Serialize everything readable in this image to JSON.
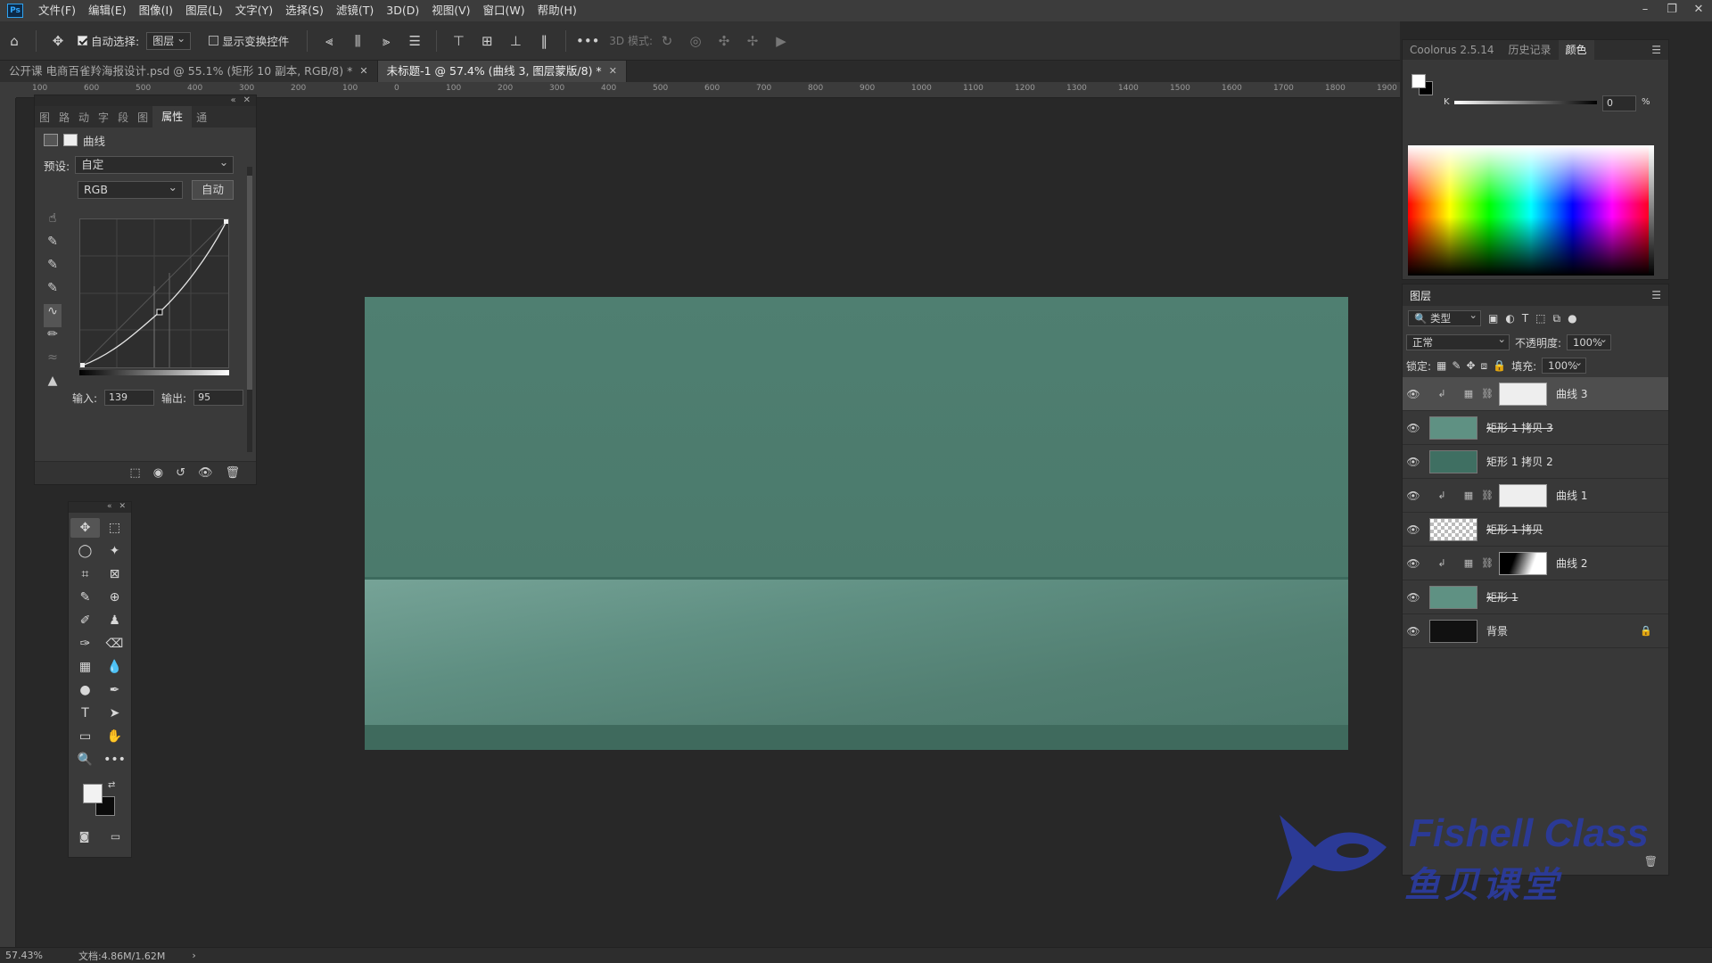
{
  "menubar": {
    "items": [
      "文件(F)",
      "编辑(E)",
      "图像(I)",
      "图层(L)",
      "文字(Y)",
      "选择(S)",
      "滤镜(T)",
      "3D(D)",
      "视图(V)",
      "窗口(W)",
      "帮助(H)"
    ]
  },
  "options": {
    "auto_select_label": "自动选择:",
    "auto_select_value": "图层",
    "show_transform_label": "显示变换控件",
    "mode_3d_label": "3D 模式:"
  },
  "tabs": [
    {
      "label": "公开课 电商百雀羚海报设计.psd @ 55.1% (矩形 10 副本, RGB/8) *"
    },
    {
      "label": "未标题-1 @ 57.4% (曲线 3, 图层蒙版/8) *"
    }
  ],
  "ruler": {
    "h_ticks": [
      "100",
      "600",
      "500",
      "400",
      "300",
      "200",
      "100",
      "0",
      "100",
      "200",
      "300",
      "400",
      "500",
      "600",
      "700",
      "800",
      "900",
      "1000",
      "1100",
      "1200",
      "1300",
      "1400",
      "1500",
      "1600",
      "1700",
      "1800",
      "1900",
      "20"
    ]
  },
  "properties": {
    "tabs": [
      "图",
      "路",
      "动",
      "字",
      "段",
      "图",
      "属性",
      "通"
    ],
    "title": "曲线",
    "preset_label": "预设:",
    "preset_value": "自定",
    "channel_value": "RGB",
    "auto_button": "自动",
    "input_label": "输入:",
    "input_value": "139",
    "output_label": "输出:",
    "output_value": "95"
  },
  "color_panel": {
    "tabs": [
      "Coolorus 2.5.14",
      "历史记录",
      "颜色"
    ],
    "k_label": "K",
    "k_value": "0",
    "percent": "%"
  },
  "layers_panel": {
    "title": "图层",
    "filter_value": "类型",
    "blend_mode": "正常",
    "opacity_label": "不透明度:",
    "opacity_value": "100%",
    "lock_label": "锁定:",
    "fill_label": "填充:",
    "fill_value": "100%",
    "layers": [
      {
        "name": "曲线 3",
        "type": "adjustment",
        "mask": "white",
        "active": true
      },
      {
        "name": "矩形 1 拷贝 3",
        "type": "shape",
        "thumb": "#5f9183",
        "strike": true
      },
      {
        "name": "矩形 1 拷贝 2",
        "type": "shape",
        "thumb": "#3f6f62",
        "strike": false
      },
      {
        "name": "曲线 1",
        "type": "adjustment",
        "mask": "white"
      },
      {
        "name": "矩形 1 拷贝",
        "type": "shape",
        "thumb": "checker",
        "strike": true
      },
      {
        "name": "曲线 2",
        "type": "adjustment",
        "mask": "gradient"
      },
      {
        "name": "矩形 1",
        "type": "shape",
        "thumb": "#5f9183",
        "strike": true
      },
      {
        "name": "背景",
        "type": "background",
        "thumb": "#111111",
        "locked": true
      }
    ]
  },
  "status": {
    "zoom": "57.43%",
    "doc": "文档:4.86M/1.62M"
  },
  "watermark": {
    "line1": "Fishell Class",
    "line2": "鱼贝课堂"
  }
}
